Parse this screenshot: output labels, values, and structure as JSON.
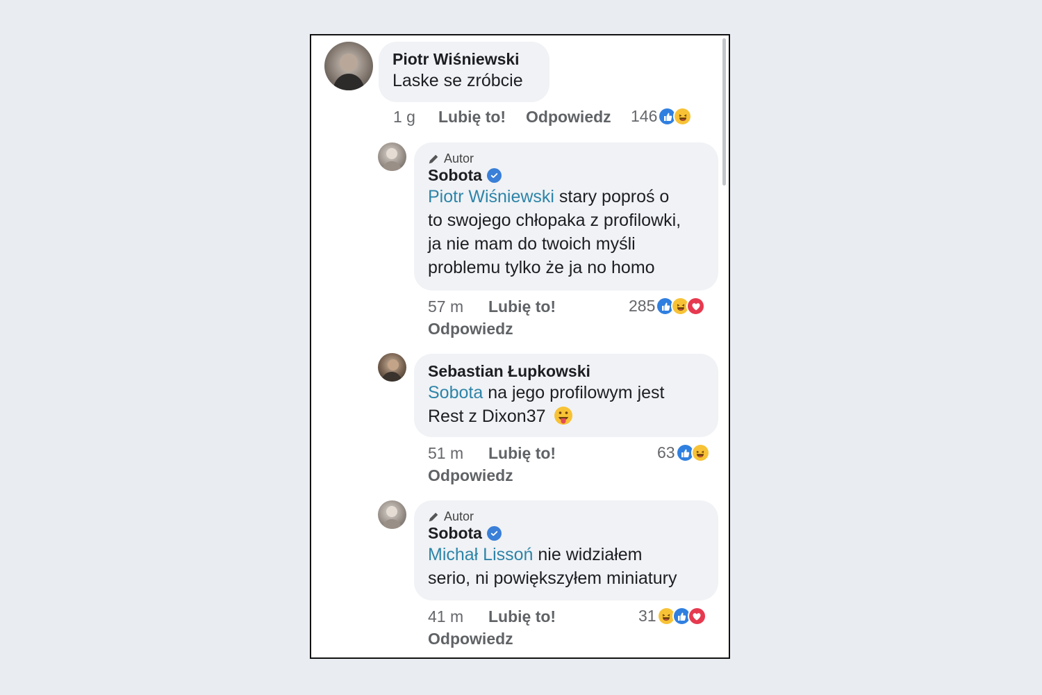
{
  "comments": [
    {
      "author": "Piotr Wiśniewski",
      "text": "Laske se zróbcie",
      "time": "1 g",
      "like_label": "Lubię to!",
      "reply_label": "Odpowiedz",
      "reaction_count": "146",
      "reactions": [
        "like",
        "haha"
      ]
    },
    {
      "author_tag": "Autor",
      "author": "Sobota",
      "verified": true,
      "mention": "Piotr Wiśniewski",
      "text_lines": [
        " stary poproś o",
        "to swojego chłopaka z profilowki,",
        "ja nie mam do twoich myśli",
        "problemu tylko że ja no homo"
      ],
      "time": "57 m",
      "like_label": "Lubię to!",
      "reply_label": "Odpowiedz",
      "reaction_count": "285",
      "reactions": [
        "like",
        "haha",
        "love"
      ]
    },
    {
      "author": "Sebastian Łupkowski",
      "mention": "Sobota",
      "text_lines": [
        " na jego profilowym jest",
        "Rest z Dixon37"
      ],
      "emoji": "tongue-face",
      "time": "51 m",
      "like_label": "Lubię to!",
      "reply_label": "Odpowiedz",
      "reaction_count": "63",
      "reactions": [
        "like",
        "haha"
      ]
    },
    {
      "author_tag": "Autor",
      "author": "Sobota",
      "verified": true,
      "mention": "Michał Lissoń",
      "text_lines": [
        " nie widziałem",
        "serio, ni powiększyłem miniatury"
      ],
      "time": "41 m",
      "like_label": "Lubię to!",
      "reply_label": "Odpowiedz",
      "reaction_count": "31",
      "reactions": [
        "haha",
        "like",
        "love"
      ]
    }
  ],
  "colors": {
    "mention": "#2d84a8",
    "bubble": "#f0f2f5",
    "like": "#2f7fe0",
    "haha": "#f7c235",
    "love": "#e6394f",
    "verified": "#3a7fd8"
  },
  "icons": {
    "author": "pencil-icon",
    "verified": "verified-badge-icon"
  }
}
